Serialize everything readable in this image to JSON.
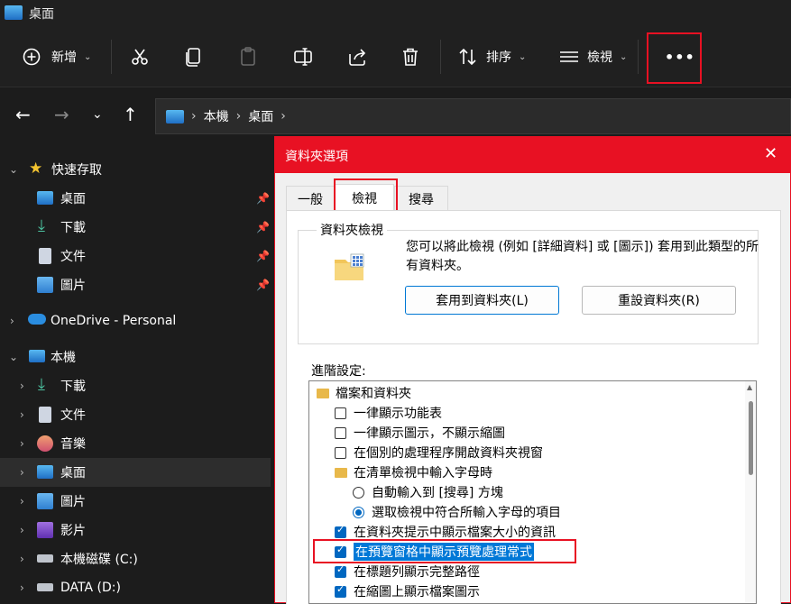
{
  "window": {
    "title": "桌面"
  },
  "toolbar": {
    "new_label": "新增",
    "sort_label": "排序",
    "view_label": "檢視",
    "more_label": "•••"
  },
  "address": {
    "segments": [
      "本機",
      "桌面"
    ]
  },
  "sidebar": {
    "items": [
      {
        "label": "快速存取"
      },
      {
        "label": "桌面"
      },
      {
        "label": "下載"
      },
      {
        "label": "文件"
      },
      {
        "label": "圖片"
      },
      {
        "label": "OneDrive - Personal"
      },
      {
        "label": "本機"
      },
      {
        "label": "下載"
      },
      {
        "label": "文件"
      },
      {
        "label": "音樂"
      },
      {
        "label": "桌面"
      },
      {
        "label": "圖片"
      },
      {
        "label": "影片"
      },
      {
        "label": "本機磁碟 (C:)"
      },
      {
        "label": "DATA (D:)"
      }
    ]
  },
  "dialog": {
    "title": "資料夾選項",
    "close": "✕",
    "tabs": [
      "一般",
      "檢視",
      "搜尋"
    ],
    "group_title": "資料夾檢視",
    "description": "您可以將此檢視 (例如 [詳細資料] 或 [圖示]) 套用到此類型的所有資料夾。",
    "apply_button": "套用到資料夾(L)",
    "reset_button": "重設資料夾(R)",
    "advanced_label": "進階設定:",
    "advanced_items": [
      {
        "text": "檔案和資料夾"
      },
      {
        "text": "一律顯示功能表"
      },
      {
        "text": "一律顯示圖示，不顯示縮圖"
      },
      {
        "text": "在個別的處理程序開啟資料夾視窗"
      },
      {
        "text": "在清單檢視中輸入字母時"
      },
      {
        "text": "自動輸入到 [搜尋] 方塊"
      },
      {
        "text": "選取檢視中符合所輸入字母的項目"
      },
      {
        "text": "在資料夾提示中顯示檔案大小的資訊"
      },
      {
        "text": "在預覽窗格中顯示預覽處理常式"
      },
      {
        "text": "在標題列顯示完整路徑"
      },
      {
        "text": "在縮圖上顯示檔案圖示"
      }
    ]
  }
}
